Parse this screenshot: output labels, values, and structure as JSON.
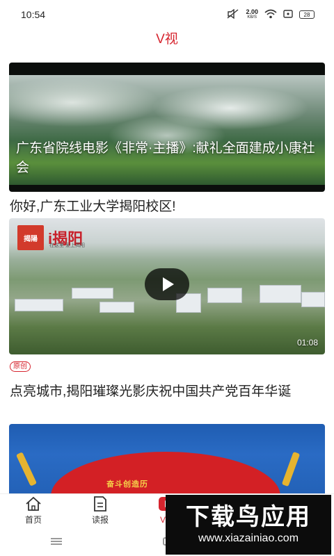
{
  "status_bar": {
    "time": "10:54",
    "net_speed_value": "2.00",
    "net_speed_unit": "KB/S",
    "battery": "28"
  },
  "header": {
    "title": "V视"
  },
  "feed": {
    "items": [
      {
        "caption": "广东省院线电影《非常·主播》:献礼全面建成小康社会",
        "headline": "你好,广东工业大学揭阳校区!"
      },
      {
        "brand": "i揭阳",
        "brand_logo_text": "揭陽",
        "brand_sub": "在这里 爱上揭阳",
        "duration": "01:08",
        "badge": "原创",
        "headline": "点亮城市,揭阳璀璨光影庆祝中国共产党百年华诞"
      },
      {
        "banner_text": "奋斗创造历"
      }
    ]
  },
  "tabs": [
    {
      "label": "首页",
      "icon": "home-icon",
      "active": false
    },
    {
      "label": "读报",
      "icon": "newspaper-icon",
      "active": false
    },
    {
      "label": "V视",
      "icon": "video-play-icon",
      "active": true
    }
  ],
  "watermark": {
    "title": "下载鸟应用",
    "url": "www.xiazainiao.com"
  },
  "colors": {
    "accent": "#d6242e",
    "text": "#222222"
  }
}
